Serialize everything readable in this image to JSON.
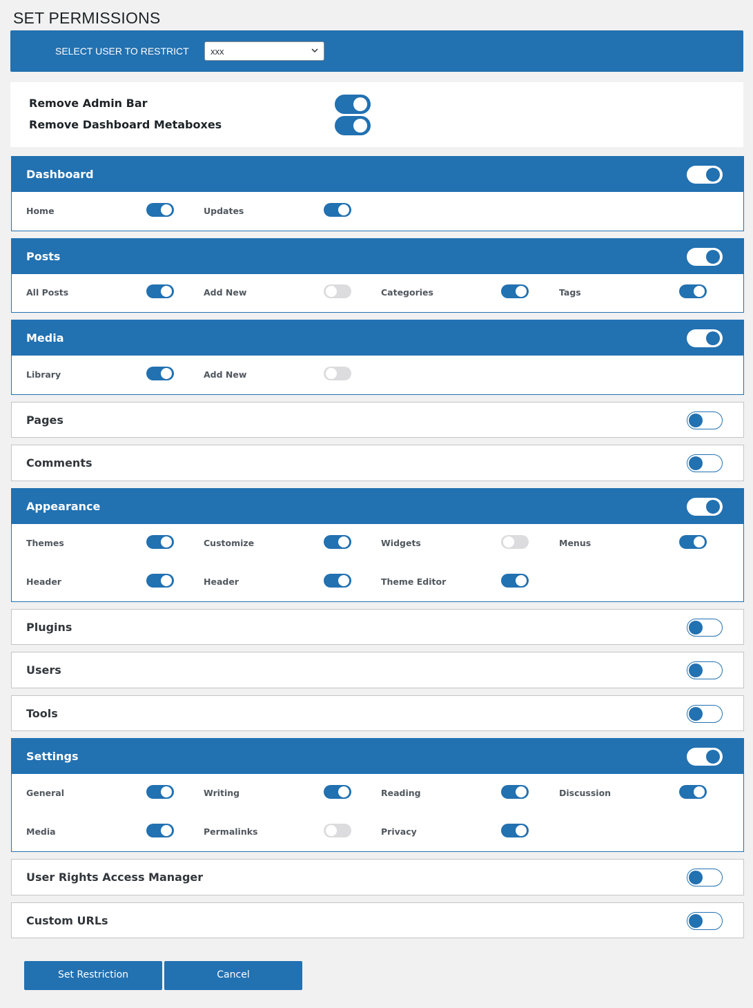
{
  "page_title": "SET PERMISSIONS",
  "user_bar": {
    "label": "SELECT USER TO RESTRICT",
    "selected_user": "xxx"
  },
  "top_options": [
    {
      "label": "Remove Admin Bar",
      "enabled": true
    },
    {
      "label": "Remove Dashboard Metaboxes",
      "enabled": true
    }
  ],
  "sections": {
    "dashboard": {
      "title": "Dashboard",
      "enabled": true,
      "items": [
        {
          "label": "Home",
          "enabled": true
        },
        {
          "label": "Updates",
          "enabled": true
        }
      ]
    },
    "posts": {
      "title": "Posts",
      "enabled": true,
      "items": [
        {
          "label": "All Posts",
          "enabled": true
        },
        {
          "label": "Add New",
          "enabled": false
        },
        {
          "label": "Categories",
          "enabled": true
        },
        {
          "label": "Tags",
          "enabled": true
        }
      ]
    },
    "media": {
      "title": "Media",
      "enabled": true,
      "items": [
        {
          "label": "Library",
          "enabled": true
        },
        {
          "label": "Add New",
          "enabled": false
        }
      ]
    },
    "pages": {
      "title": "Pages",
      "enabled": false
    },
    "comments": {
      "title": "Comments",
      "enabled": false
    },
    "appearance": {
      "title": "Appearance",
      "enabled": true,
      "items": [
        {
          "label": "Themes",
          "enabled": true
        },
        {
          "label": "Customize",
          "enabled": true
        },
        {
          "label": "Widgets",
          "enabled": false
        },
        {
          "label": "Menus",
          "enabled": true
        },
        {
          "label": "Header",
          "enabled": true
        },
        {
          "label": "Header",
          "enabled": true
        },
        {
          "label": "Theme Editor",
          "enabled": true
        }
      ]
    },
    "plugins": {
      "title": "Plugins",
      "enabled": false
    },
    "users": {
      "title": "Users",
      "enabled": false
    },
    "tools": {
      "title": "Tools",
      "enabled": false
    },
    "settings": {
      "title": "Settings",
      "enabled": true,
      "items": [
        {
          "label": "General",
          "enabled": true
        },
        {
          "label": "Writing",
          "enabled": true
        },
        {
          "label": "Reading",
          "enabled": true
        },
        {
          "label": "Discussion",
          "enabled": true
        },
        {
          "label": "Media",
          "enabled": true
        },
        {
          "label": "Permalinks",
          "enabled": false
        },
        {
          "label": "Privacy",
          "enabled": true
        }
      ]
    },
    "user_rights": {
      "title": "User Rights Access Manager",
      "enabled": false
    },
    "custom_urls": {
      "title": "Custom URLs",
      "enabled": false
    }
  },
  "buttons": {
    "set_restriction": "Set Restriction",
    "cancel": "Cancel"
  },
  "colors": {
    "accent": "#2271b1",
    "toggle_off": "#dcdcde",
    "background": "#f1f1f1"
  }
}
